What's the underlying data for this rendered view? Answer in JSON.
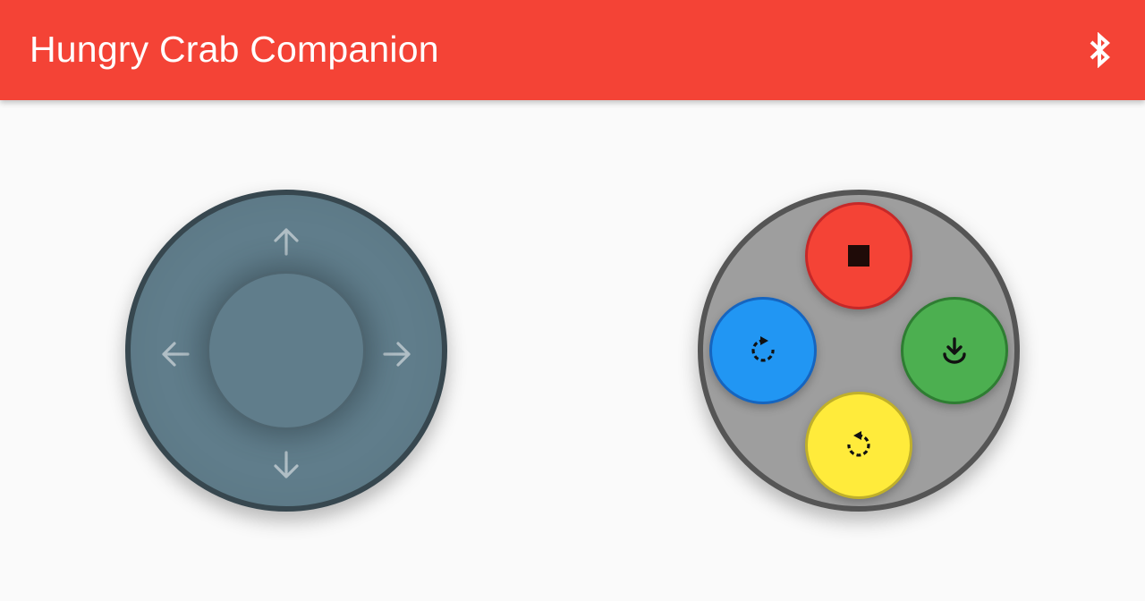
{
  "app_bar": {
    "title": "Hungry Crab Companion",
    "background": "#f44336",
    "bluetooth_icon": "bluetooth-icon"
  },
  "joystick": {
    "base_color": "#607d8b",
    "ring_color": "#37474f",
    "arrow_color": "#b0bec5",
    "arrows": [
      "arrow-up-icon",
      "arrow-down-icon",
      "arrow-left-icon",
      "arrow-right-icon"
    ]
  },
  "action_pad": {
    "background": "#9e9e9e",
    "ring_color": "#555555",
    "buttons": [
      {
        "name": "stop",
        "icon": "stop-icon",
        "color": "#f44336",
        "border": "#c62828"
      },
      {
        "name": "rotate-cw",
        "icon": "rotate-right-icon",
        "color": "#2196f3",
        "border": "#1565c0"
      },
      {
        "name": "grab",
        "icon": "download-icon",
        "color": "#4caf50",
        "border": "#2e7d32"
      },
      {
        "name": "rotate-ccw",
        "icon": "rotate-left-icon",
        "color": "#ffeb3b",
        "border": "#c0b02a"
      }
    ]
  }
}
